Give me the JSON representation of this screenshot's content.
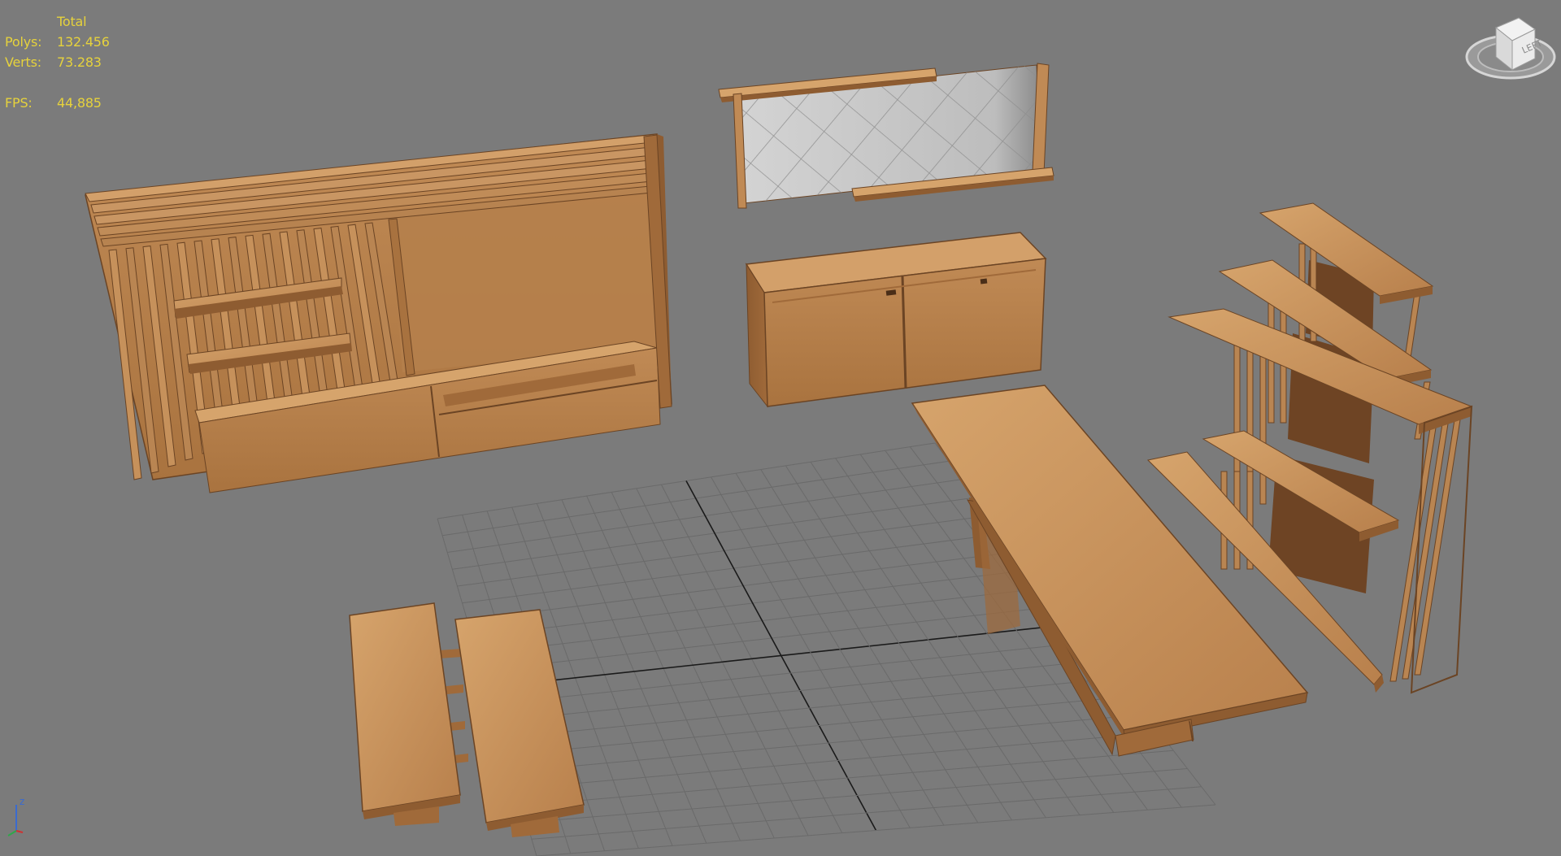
{
  "app": {
    "viewport_name": "3D perspective viewport"
  },
  "stats": {
    "header": "Total",
    "polys_label": "Polys:",
    "polys_value": "132.456",
    "verts_label": "Verts:",
    "verts_value": "73.283",
    "fps_label": "FPS:",
    "fps_value": "44,885"
  },
  "viewcube": {
    "face_label": "LEFT",
    "icon": "viewcube-icon"
  },
  "axis": {
    "label_z": "z",
    "icon": "axis-tripod-icon"
  },
  "colors": {
    "background": "#7b7b7b",
    "stats_text": "#e6d23c",
    "wood_light": "#c9955f",
    "wood_mid": "#b07b48",
    "wood_dark": "#7a4f2c",
    "grid": "#6e6e6e"
  },
  "objects": [
    {
      "name": "tv-wall-unit-model"
    },
    {
      "name": "mirror-frame-model"
    },
    {
      "name": "sideboard-cabinet-model"
    },
    {
      "name": "bookshelf-model"
    },
    {
      "name": "coffee-table-model"
    },
    {
      "name": "bench-stools-model"
    }
  ]
}
